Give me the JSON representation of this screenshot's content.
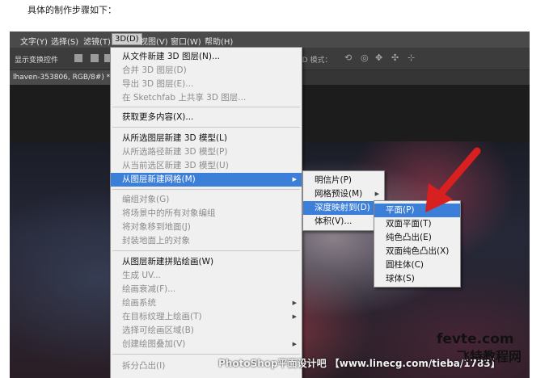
{
  "intro_text": "具体的制作步骤如下：",
  "menubar": [
    "文字(Y)",
    "选择(S)",
    "滤镜(T)",
    "3D(D)",
    "视图(V)",
    "窗口(W)",
    "帮助(H)"
  ],
  "options_bar": {
    "show_transform": "显示变换控件",
    "mode_label": "3D 模式："
  },
  "document_tab": {
    "title": "lhaven-353806, RGB/8#) *",
    "close": "×"
  },
  "menu_3d": {
    "items": [
      {
        "label": "从文件新建 3D 图层(N)...",
        "enabled": true
      },
      {
        "label": "合并 3D 图层(D)",
        "enabled": false
      },
      {
        "label": "导出 3D 图层(E)...",
        "enabled": false
      },
      {
        "label": "在 Sketchfab 上共享 3D 图层...",
        "enabled": false
      },
      {
        "label": "获取更多内容(X)...",
        "enabled": true
      },
      {
        "label": "从所选图层新建 3D 模型(L)",
        "enabled": true
      },
      {
        "label": "从所选路径新建 3D 模型(P)",
        "enabled": false
      },
      {
        "label": "从当前选区新建 3D 模型(U)",
        "enabled": false
      },
      {
        "label": "从图层新建网格(M)",
        "enabled": true,
        "highlighted": true,
        "submenu": true
      },
      {
        "label": "编组对象(G)",
        "enabled": false
      },
      {
        "label": "将场景中的所有对象编组",
        "enabled": false
      },
      {
        "label": "将对象移到地面(J)",
        "enabled": false
      },
      {
        "label": "封装地面上的对象",
        "enabled": false
      },
      {
        "label": "从图层新建拼贴绘画(W)",
        "enabled": true
      },
      {
        "label": "生成 UV...",
        "enabled": false
      },
      {
        "label": "绘画衰减(F)...",
        "enabled": false
      },
      {
        "label": "绘画系统",
        "enabled": false,
        "submenu": true
      },
      {
        "label": "在目标纹理上绘画(T)",
        "enabled": false,
        "submenu": true
      },
      {
        "label": "选择可绘画区域(B)",
        "enabled": false
      },
      {
        "label": "创建绘图叠加(V)",
        "enabled": false,
        "submenu": true
      },
      {
        "label": "拆分凸出(I)",
        "enabled": false
      }
    ]
  },
  "submenu_mesh": {
    "items": [
      {
        "label": "明信片(P)",
        "enabled": true
      },
      {
        "label": "网格预设(M)",
        "enabled": true,
        "submenu": true
      },
      {
        "label": "深度映射到(D)",
        "enabled": true,
        "highlighted": true,
        "submenu": true
      },
      {
        "label": "体积(V)...",
        "enabled": true
      }
    ]
  },
  "submenu_depth": {
    "items": [
      {
        "label": "平面(P)",
        "enabled": true,
        "highlighted": true
      },
      {
        "label": "双面平面(T)",
        "enabled": true
      },
      {
        "label": "纯色凸出(E)",
        "enabled": true
      },
      {
        "label": "双面纯色凸出(X)",
        "enabled": true
      },
      {
        "label": "圆柱体(C)",
        "enabled": true
      },
      {
        "label": "球体(S)",
        "enabled": true
      }
    ]
  },
  "watermarks": {
    "fevte": "fevte.com",
    "feite": "飞特教程网",
    "bottom": "PhotoShop平面设计吧 【www.linecg.com/tieba/1783】"
  },
  "colors": {
    "highlight": "#3c7fd8",
    "arrow": "#d92020",
    "menu_bg": "#f0f0f0",
    "ui_dark": "#3c3c3c"
  }
}
